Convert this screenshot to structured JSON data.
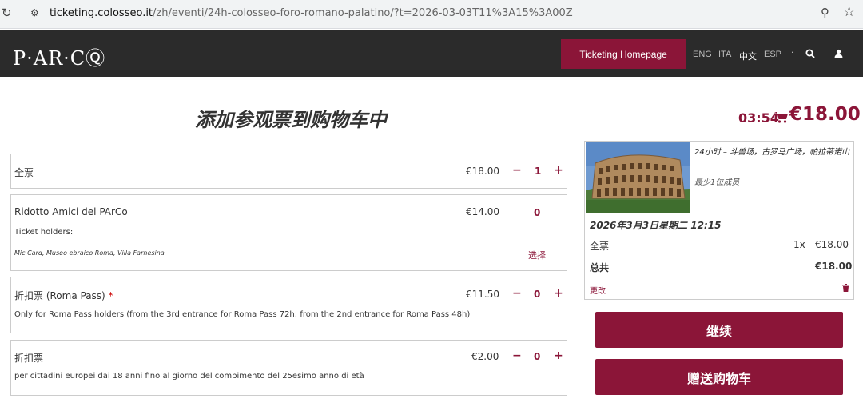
{
  "browser": {
    "reload_icon": "reload-icon",
    "url_host": "ticketing.colosseo.it",
    "url_path": "/zh/eventi/24h-colosseo-foro-romano-palatino/?t=2026-03-03T11%3A15%3A00Z",
    "zoom_icon": "zoom-icon",
    "bookmark_icon": "star-icon"
  },
  "header": {
    "logo": "P·AR·C",
    "homepage_button": "Ticketing Homepage",
    "languages": [
      "ENG",
      "ITA",
      "中文",
      "ESP"
    ],
    "active_language": "中文",
    "separator": "·"
  },
  "page": {
    "title": "添加参观票到购物车中",
    "timer": "03:54",
    "cart_total": "€18.00"
  },
  "tickets": [
    {
      "name": "全票",
      "price": "€18.00",
      "qty": "1"
    },
    {
      "name": "Ridotto Amici del PArCo",
      "price": "€14.00",
      "qty": "0",
      "holders_label": "Ticket holders:",
      "holders": "Mic Card, Museo ebraico Roma, Villa Farnesina",
      "select_label": "选择"
    },
    {
      "name": "折扣票 (Roma Pass)",
      "required_mark": "*",
      "price": "€11.50",
      "qty": "0",
      "description": "Only for Roma Pass holders (from the 3rd entrance for Roma Pass 72h; from the 2nd entrance for Roma Pass 48h)"
    },
    {
      "name": "折扣票",
      "price": "€2.00",
      "qty": "0",
      "description": "per cittadini europei dai 18 anni fino al giorno del compimento del 25esimo anno di età"
    }
  ],
  "controls": {
    "minus": "−",
    "plus": "+"
  },
  "summary": {
    "title": "24小时 – 斗兽场，古罗马广场，帕拉蒂诺山",
    "min_members": "最少1位成员",
    "date": "2026年3月3日星期二 12:15",
    "line_label": "全票",
    "line_qty": "1x",
    "line_price": "€18.00",
    "total_label": "总共",
    "total_value": "€18.00",
    "change_label": "更改"
  },
  "actions": {
    "continue_label": "继续",
    "gift_label": "赠送购物车"
  }
}
